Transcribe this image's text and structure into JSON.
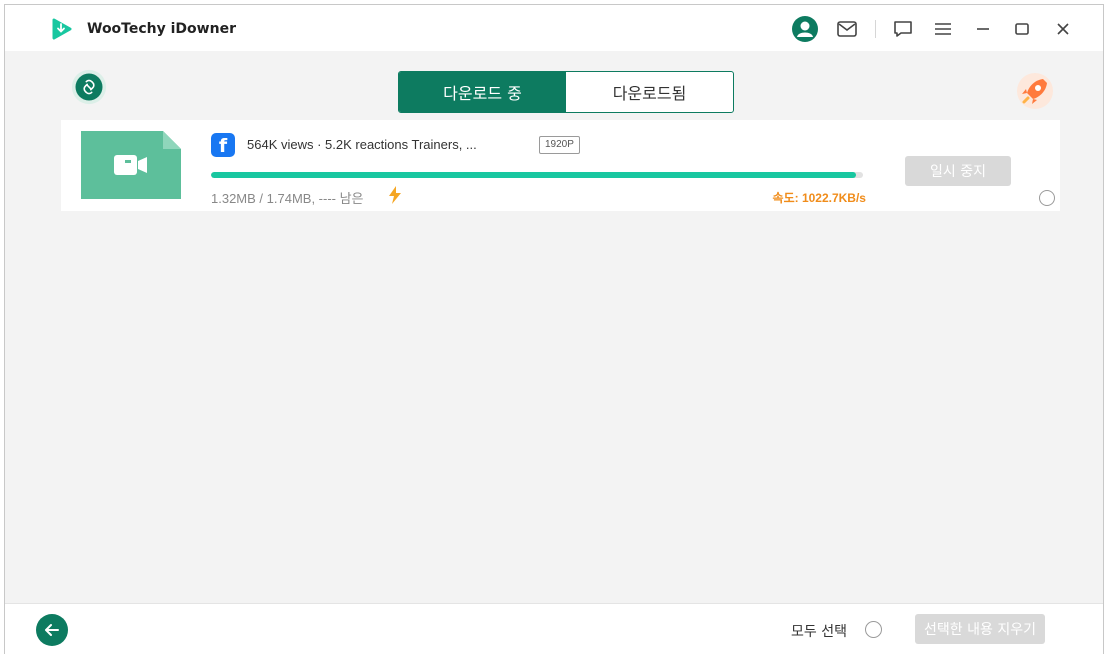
{
  "app": {
    "title": "WooTechy iDowner",
    "accent_color": "#0d7b60"
  },
  "titlebar": {
    "icons": [
      "user-icon",
      "mail-icon",
      "chat-icon",
      "menu-icon",
      "minimize-icon",
      "maximize-icon",
      "close-icon"
    ]
  },
  "tabs": [
    {
      "label": "다운로드 중",
      "active": true
    },
    {
      "label": "다운로드됨",
      "active": false
    }
  ],
  "download_item": {
    "source_icon": "facebook-icon",
    "title": "564K views · 5.2K reactions  Trainers, ...",
    "resolution": "1920P",
    "progress_percent": 99,
    "size_text": "1.32MB / 1.74MB, ---- 남은",
    "speed_text": "속도: 1022.7KB/s",
    "pause_label": "일시 중지"
  },
  "bottom": {
    "select_all_label": "모두 선택",
    "delete_selected_label": "선택한 내용 지우기"
  }
}
